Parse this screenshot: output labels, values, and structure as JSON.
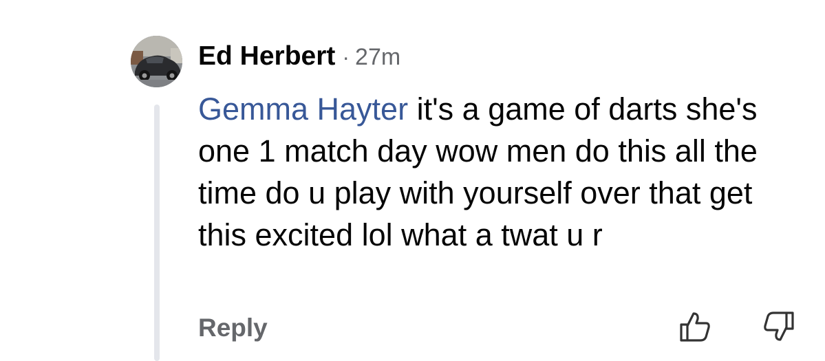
{
  "comment": {
    "author": "Ed Herbert",
    "separator": "·",
    "time": "27m",
    "mention": "Gemma Hayter",
    "text": " it's a game of darts she's one 1 match day wow men do this all the time do u play with yourself over that get this excited lol what a twat u r"
  },
  "actions": {
    "reply_label": "Reply",
    "upvote_icon": "thumbs-up-icon",
    "downvote_icon": "thumbs-down-icon"
  },
  "colors": {
    "mention": "#385898",
    "secondary_text": "#65676b",
    "thread_line": "#e4e6eb"
  }
}
